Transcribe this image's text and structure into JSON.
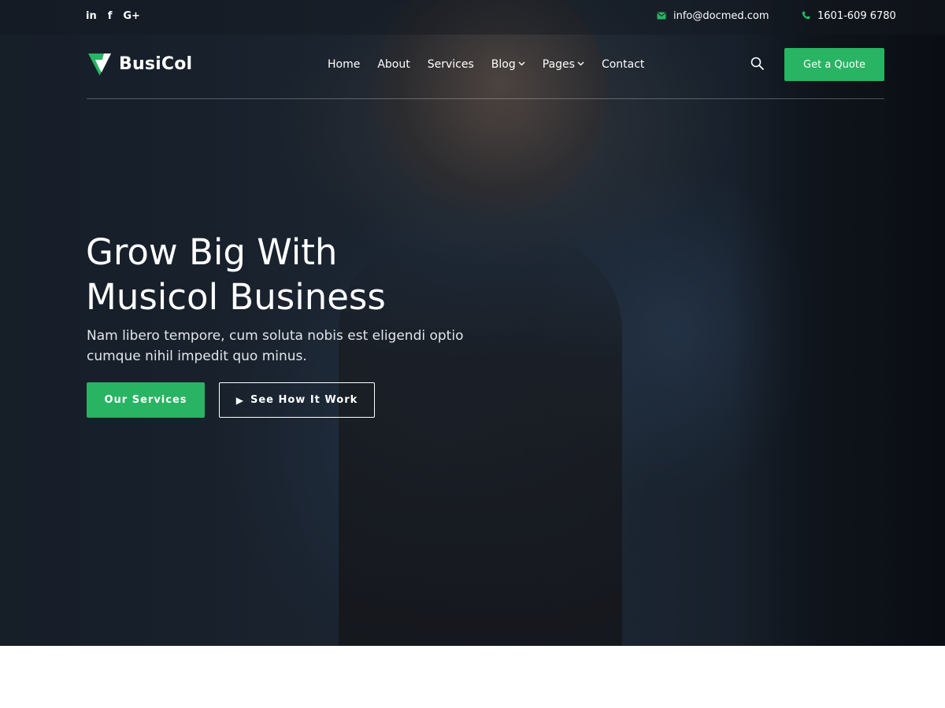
{
  "topbar": {
    "social": [
      {
        "name": "linkedin-icon",
        "glyph": "in"
      },
      {
        "name": "facebook-icon",
        "glyph": "f"
      },
      {
        "name": "google-plus-icon",
        "glyph": "G+"
      }
    ],
    "email": "info@docmed.com",
    "phone": "1601-609 6780"
  },
  "header": {
    "logo_text": "BusiCol",
    "nav": [
      {
        "label": "Home"
      },
      {
        "label": "About"
      },
      {
        "label": "Services"
      },
      {
        "label": "Blog",
        "chevron": "⌄"
      },
      {
        "label": "Pages",
        "chevron": "⌄"
      },
      {
        "label": "Contact"
      }
    ],
    "cta_label": "Get a Quote"
  },
  "hero": {
    "headline_line1": "Grow Big With",
    "headline_line2": "Musicol Business",
    "subtext_line1": "Nam libero tempore, cum soluta nobis est eligendi optio",
    "subtext_line2": "cumque nihil impedit quo minus.",
    "primary_button": "Our Services",
    "secondary_button": "See How It Work",
    "play_glyph": "▶"
  },
  "colors": {
    "accent": "#28b463",
    "text": "#ffffff"
  }
}
